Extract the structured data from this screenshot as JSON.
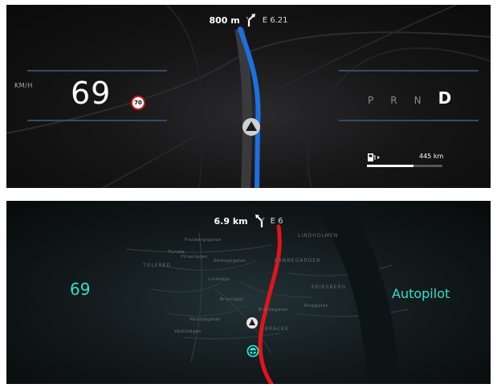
{
  "cluster_standard": {
    "navigation": {
      "distance": "800 m",
      "road": "E 6.21",
      "maneuver_icon": "turn-slight-right-icon"
    },
    "speed": {
      "unit": "KM/H",
      "value": "69"
    },
    "speed_limit": "70",
    "gears": [
      {
        "label": "P",
        "active": false
      },
      {
        "label": "R",
        "active": false
      },
      {
        "label": "N",
        "active": false
      },
      {
        "label": "D",
        "active": true
      }
    ],
    "fuel": {
      "icon": "fuel-pump-icon",
      "range": "445 km",
      "level": 0.62
    },
    "colors": {
      "route": "#1e6fe0",
      "speed_limit_ring": "#d0161a"
    }
  },
  "cluster_autopilot": {
    "navigation": {
      "distance": "6.9 km",
      "road": "E 6",
      "maneuver_icon": "turn-slight-left-icon"
    },
    "speed": "69",
    "mode": "Autopilot",
    "colors": {
      "accent": "#35e0c8",
      "route": "#e0141c"
    },
    "map_labels": [
      "LINDHOLMEN",
      "KANNEGARDEN",
      "ERIKSBERG",
      "TOLERED",
      "BRACKE",
      "Fraxbergsgatan",
      "Furuda",
      "Ytraallagen",
      "Sörengsgatan",
      "Västiljegatan",
      "Bräckegatan",
      "Lindvägs",
      "Brunnlgat",
      "Ringgatan",
      "Västilsägen"
    ]
  }
}
